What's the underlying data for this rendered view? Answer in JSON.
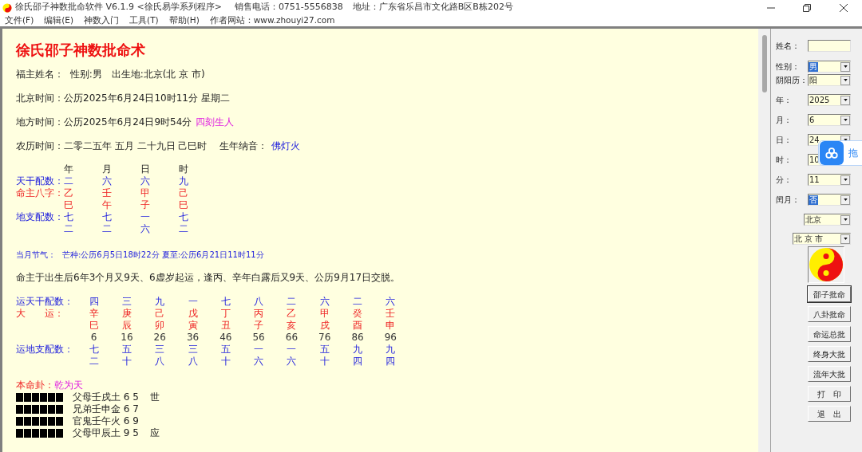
{
  "window": {
    "title": "徐氏邵子神数批命软件 V6.1.9 <徐氏易学系列程序>",
    "phone": "销售电话：0751-5556838",
    "address": "地址：广东省乐昌市文化路B区B栋202号"
  },
  "menu": [
    {
      "label": "文件(F)"
    },
    {
      "label": "编辑(E)"
    },
    {
      "label": "神数入门"
    },
    {
      "label": "工具(T)"
    },
    {
      "label": "帮助(H)"
    }
  ],
  "website": "作者网站：www.zhouyi27.com",
  "report": {
    "title": "徐氏邵子神数批命术",
    "info_lines": [
      {
        "segments": [
          {
            "text": "福主姓名：  性别:男　出生地:北京(北 京 市)",
            "kind": "plain"
          }
        ]
      },
      {
        "segments": [
          {
            "text": "北京时间：公历2025年6月24日10时11分 星期二",
            "kind": "plain"
          }
        ]
      },
      {
        "segments": [
          {
            "text": "地方时间：公历2025年6月24日9时54分",
            "kind": "plain"
          },
          {
            "text": "四刻生人",
            "kind": "note"
          }
        ]
      },
      {
        "segments": [
          {
            "text": "农历时间：二零二五年 五月 二十九日 己巳时　 生年纳音：",
            "kind": "plain"
          },
          {
            "text": "佛灯火",
            "kind": "nayin"
          }
        ]
      }
    ],
    "bazi": {
      "columns": [
        "年",
        "月",
        "日",
        "时"
      ],
      "rows": [
        {
          "label": "天干配数：",
          "kind": "number",
          "cells": [
            "二",
            "六",
            "六",
            "九"
          ]
        },
        {
          "label": "命主八字：",
          "kind": "pillar",
          "cells": [
            "乙",
            "壬",
            "甲",
            "己"
          ]
        },
        {
          "kind": "pillar",
          "cells": [
            "巳",
            "午",
            "子",
            "巳"
          ]
        },
        {
          "label": "地支配数：",
          "kind": "number",
          "cells": [
            "七",
            "七",
            "一",
            "七"
          ]
        },
        {
          "kind": "number",
          "cells": [
            "二",
            "二",
            "六",
            "二"
          ]
        }
      ]
    },
    "solar_terms": {
      "label": "当月节气：",
      "value": "芒种:公历6月5日18时22分 夏至:公历6月21日11时11分"
    },
    "luck_start": "命主于出生后6年3个月又9天、6虚岁起运，逢丙、辛年白露后又9天、公历9月17日交脱。",
    "luck": {
      "rows": [
        {
          "label": "运天干配数：",
          "kind": "number",
          "cells": [
            "四",
            "三",
            "九",
            "一",
            "七",
            "八",
            "二",
            "六",
            "二",
            "六"
          ]
        },
        {
          "label": "大　　运：",
          "kind": "pillar",
          "cells": [
            "辛",
            "庚",
            "己",
            "戊",
            "丁",
            "丙",
            "乙",
            "甲",
            "癸",
            "壬"
          ]
        },
        {
          "kind": "pillar",
          "cells": [
            "巳",
            "辰",
            "卯",
            "寅",
            "丑",
            "子",
            "亥",
            "戌",
            "酉",
            "申"
          ]
        },
        {
          "kind": "age",
          "cells": [
            "6",
            "16",
            "26",
            "36",
            "46",
            "56",
            "66",
            "76",
            "86",
            "96"
          ]
        },
        {
          "label": "运地支配数：",
          "kind": "number",
          "cells": [
            "七",
            "五",
            "三",
            "三",
            "五",
            "一",
            "一",
            "五",
            "九",
            "九"
          ]
        },
        {
          "kind": "number",
          "cells": [
            "二",
            "十",
            "八",
            "八",
            "十",
            "六",
            "六",
            "十",
            "四",
            "四"
          ]
        }
      ]
    },
    "hexagram": {
      "label": "本命卦：",
      "name": "乾为天",
      "lines": [
        {
          "kind": "yang",
          "text": "父母壬戌土 6 5",
          "mark": "世"
        },
        {
          "kind": "yang",
          "text": "兄弟壬申金 6 7"
        },
        {
          "kind": "yang",
          "text": "官鬼壬午火 6 9"
        },
        {
          "kind": "yang",
          "text": "父母甲辰土 9 5",
          "mark": "应"
        }
      ]
    }
  },
  "form": {
    "fields": [
      {
        "kind": "text",
        "label": "姓名："
      },
      {
        "kind": "select",
        "label": "性别：",
        "value": "男",
        "highlighted": true
      },
      {
        "kind": "select",
        "label": "阴阳历：",
        "value": "阳",
        "highlighted": false
      },
      {
        "kind": "select",
        "label": "年：",
        "value": "2025",
        "highlighted": false
      },
      {
        "kind": "select",
        "label": "月：",
        "value": "6",
        "highlighted": false
      },
      {
        "kind": "select",
        "label": "日：",
        "value": "24",
        "highlighted": false
      },
      {
        "kind": "select",
        "label": "时：",
        "value": "10",
        "highlighted": false
      },
      {
        "kind": "select",
        "label": "分：",
        "value": "11",
        "highlighted": false
      },
      {
        "kind": "select",
        "label": "闰月：",
        "value": "否",
        "highlighted": true
      }
    ],
    "province": "北京",
    "city": "北 京 市",
    "buttons": [
      {
        "label": "邵子批命",
        "default": true
      },
      {
        "label": "八卦批命",
        "default": false
      },
      {
        "label": "命运总批",
        "default": false
      },
      {
        "label": "终身大批",
        "default": false
      },
      {
        "label": "流年大批",
        "default": false
      },
      {
        "label": "打　印",
        "default": false
      },
      {
        "label": "退　出",
        "default": false
      }
    ]
  },
  "floating_widget": {
    "label": "拖"
  }
}
